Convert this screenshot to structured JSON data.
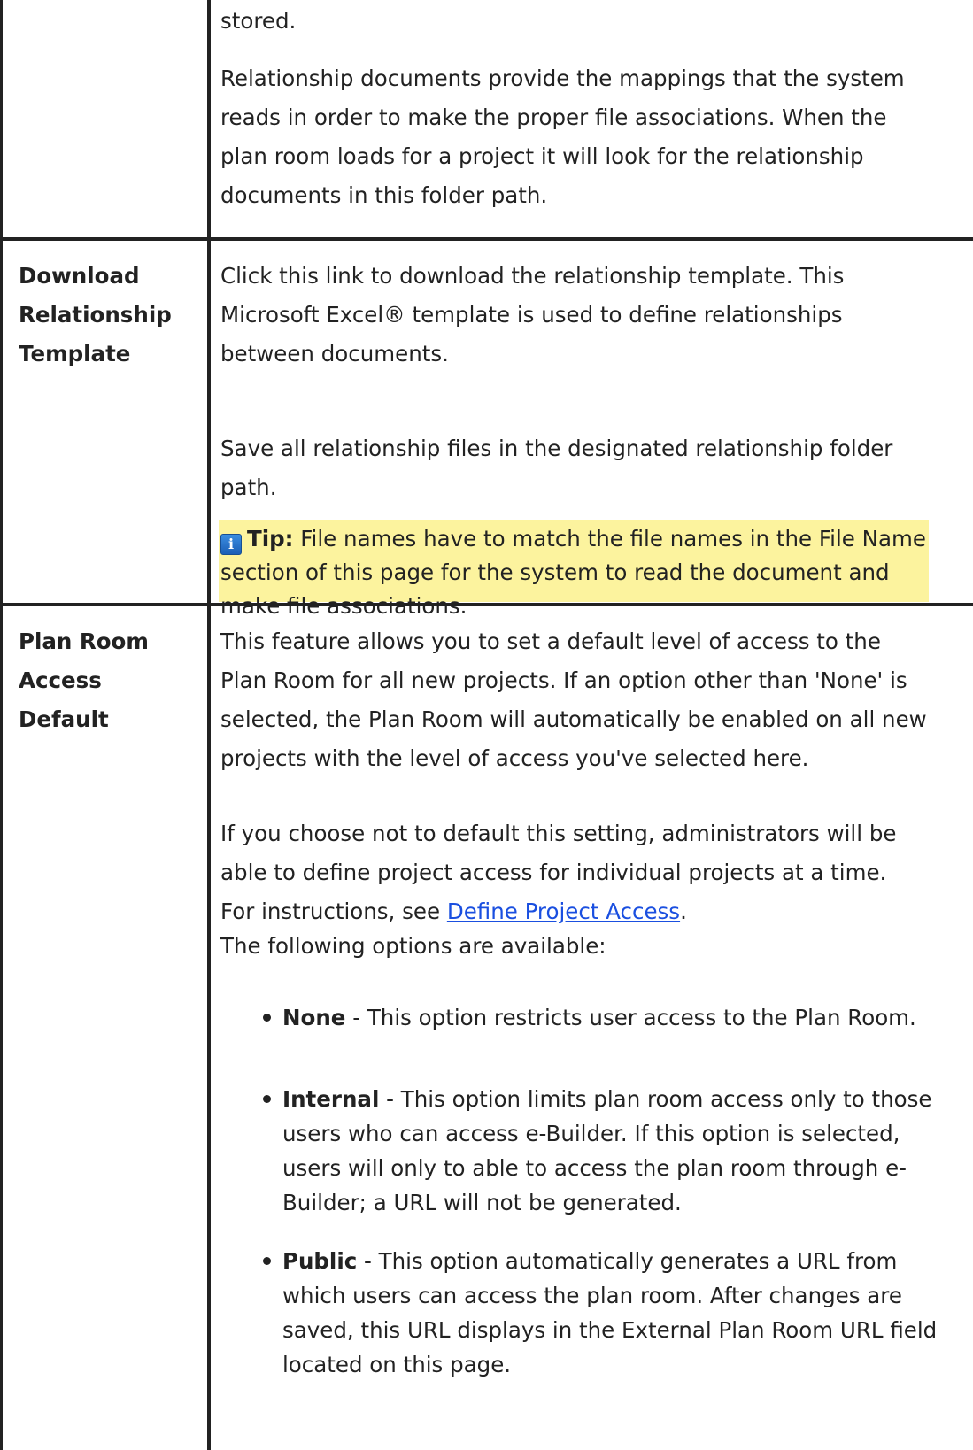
{
  "rows": [
    {
      "term": "",
      "paragraphs": [
        "stored.",
        "Relationship documents provide the mappings that the system reads in order to make the proper file associations. When the plan room loads for a project it will look for the relationship documents in this folder path."
      ]
    },
    {
      "term": "Download Relationship Template",
      "paragraphs": [
        "Click this link to download the relationship template. This Microsoft Excel® template is used to define relationships between documents.",
        "Save all relationship files in the designated relationship folder path."
      ],
      "tip": {
        "label": "Tip:",
        "text": "File names have to match the file names in the File Name section of this page for the system to read the document and make file associations.",
        "icon": "info-icon"
      }
    },
    {
      "term": "Plan Room Access Default",
      "paragraphs": [
        "This feature allows you to set a default level of access to the Plan Room for all new projects. If an option other than 'None' is selected, the Plan Room will automatically be enabled on all new projects with the level of access you've selected here.",
        "If you choose not to default this setting, administrators will be able to define project access for individual projects at a time.",
        "The following options are available:"
      ],
      "instructions_prefix": "For instructions, see ",
      "link_text": "Define Project Access",
      "link_suffix": ".",
      "options": [
        {
          "name": "None",
          "description": " - This option restricts user access to the Plan Room."
        },
        {
          "name": "Internal",
          "description": " - This option limits plan room access only to those users who can access e-Builder. If this option is selected, users will only to able to access the plan room through e-Builder; a URL will not be generated."
        },
        {
          "name": "Public",
          "description": " - This option automatically generates a URL from which users can access the plan room. After changes are saved, this URL displays in the External Plan Room URL field located on this page."
        }
      ]
    }
  ]
}
